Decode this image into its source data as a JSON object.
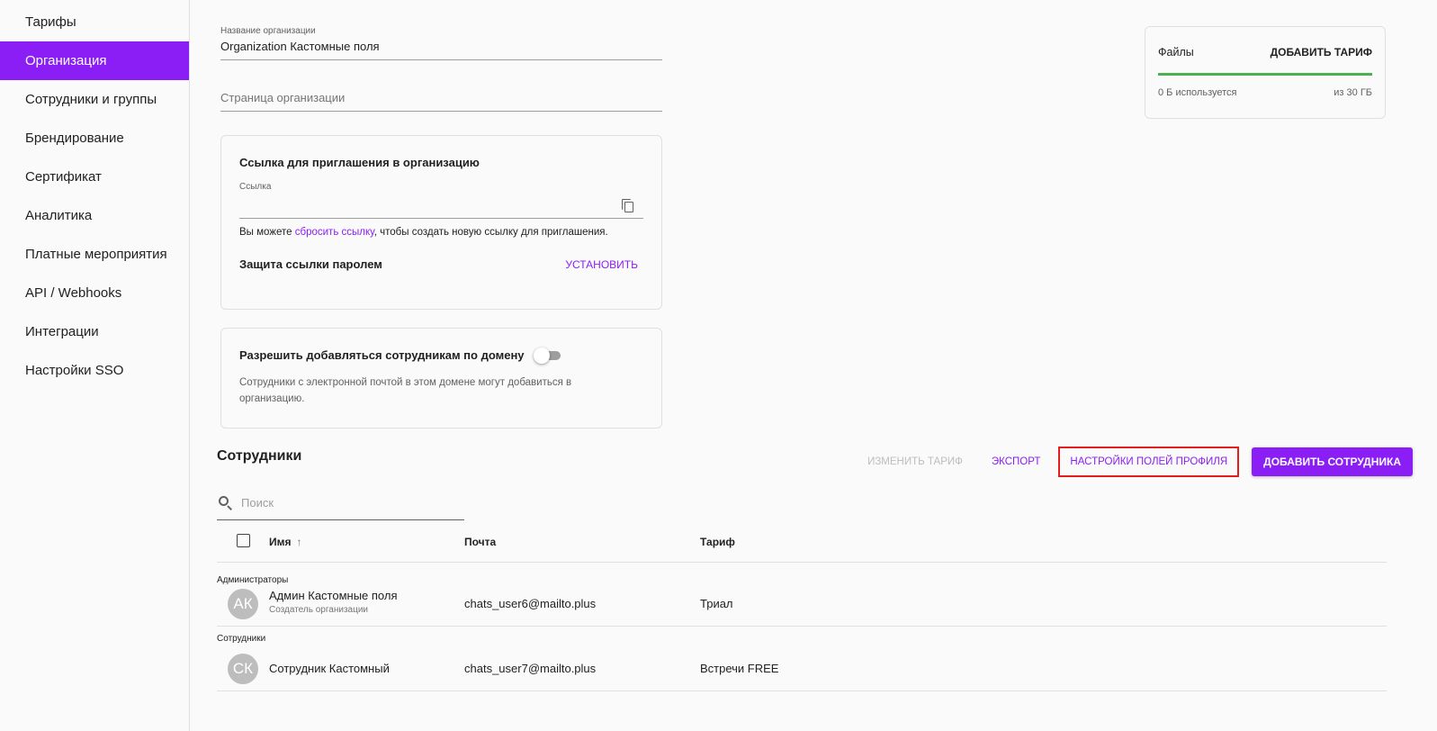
{
  "sidebar": {
    "items": [
      {
        "label": "Тарифы"
      },
      {
        "label": "Организация"
      },
      {
        "label": "Сотрудники и группы"
      },
      {
        "label": "Брендирование"
      },
      {
        "label": "Сертификат"
      },
      {
        "label": "Аналитика"
      },
      {
        "label": "Платные мероприятия"
      },
      {
        "label": "API / Webhooks"
      },
      {
        "label": "Интеграции"
      },
      {
        "label": "Настройки SSO"
      }
    ],
    "active_index": 1
  },
  "org": {
    "name_label": "Название организации",
    "name_value": "Organization Кастомные поля",
    "page_placeholder": "Страница организации"
  },
  "invite": {
    "title": "Ссылка для приглашения в организацию",
    "link_label": "Ссылка",
    "link_value": "",
    "hint_prefix": "Вы можете ",
    "hint_link": "сбросить ссылку",
    "hint_suffix": ", чтобы создать новую ссылку для приглашения.",
    "password_label": "Защита ссылки паролем",
    "password_action": "УСТАНОВИТЬ"
  },
  "domain": {
    "title": "Разрешить добавляться сотрудникам по домену",
    "toggle_on": false,
    "description": "Сотрудники с электронной почтой в этом домене могут добавиться в организацию."
  },
  "files": {
    "title": "Файлы",
    "add_label": "ДОБАВИТЬ ТАРИФ",
    "used": "0 Б используется",
    "total": "из 30 ГБ",
    "bar_color": "#4caf50"
  },
  "employees": {
    "title": "Сотрудники",
    "actions": {
      "change_plan": "ИЗМЕНИТЬ ТАРИФ",
      "export": "ЭКСПОРТ",
      "profile_fields": "НАСТРОЙКИ ПОЛЕЙ ПРОФИЛЯ",
      "add_employee": "ДОБАВИТЬ СОТРУДНИКА"
    },
    "search_placeholder": "Поиск",
    "columns": {
      "name": "Имя",
      "email": "Почта",
      "plan": "Тариф"
    },
    "groups": [
      {
        "label": "Администраторы",
        "rows": [
          {
            "initials": "АК",
            "name": "Админ Кастомные поля",
            "role": "Создатель организации",
            "email": "chats_user6@mailto.plus",
            "plan": "Триал"
          }
        ]
      },
      {
        "label": "Сотрудники",
        "rows": [
          {
            "initials": "СК",
            "name": "Сотрудник Кастомный",
            "role": "",
            "email": "chats_user7@mailto.plus",
            "plan": "Встречи FREE"
          }
        ]
      }
    ]
  },
  "colors": {
    "accent": "#8b1ef5",
    "highlight_border": "#e41e1e",
    "avatar_bg": "#bdbdbd"
  }
}
